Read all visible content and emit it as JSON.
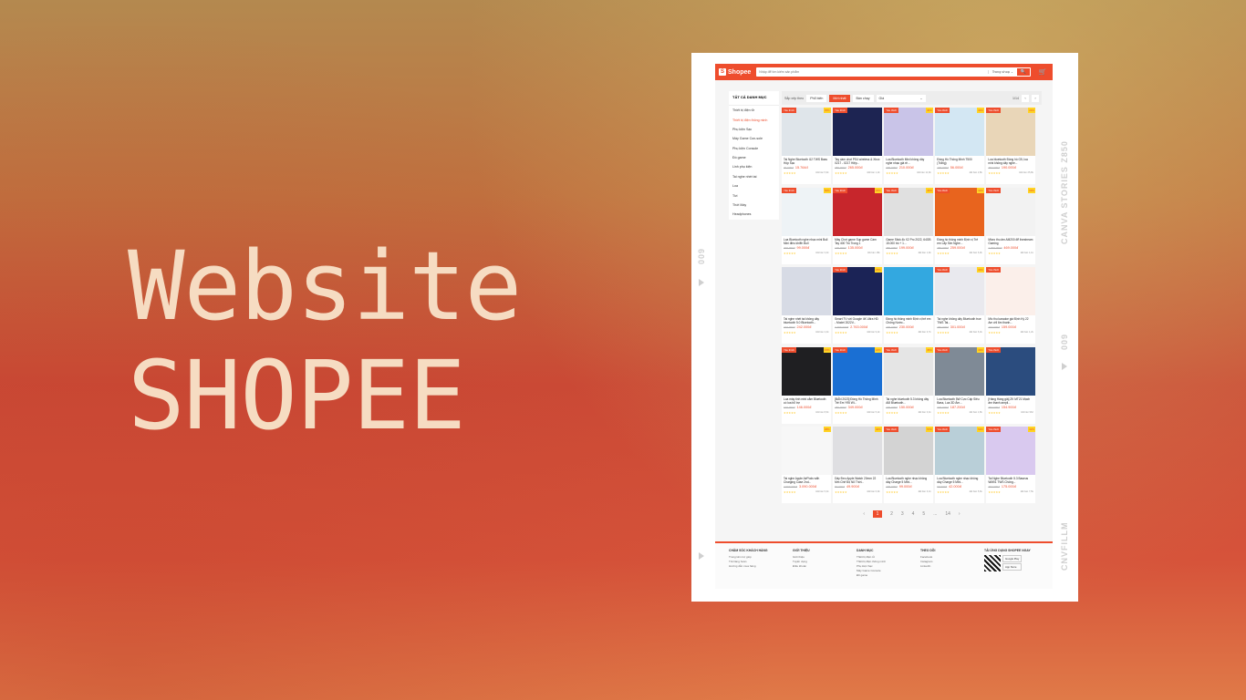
{
  "headline": {
    "line1": "Website",
    "line2": "SHOPEE"
  },
  "film": {
    "right_top": "CANVA STORIES Z850",
    "right_bottom": "CNVFILLM",
    "left_num": "009",
    "right_num": "009"
  },
  "shopee": {
    "logo": "Shopee",
    "logo_mark": "S",
    "search_placeholder": "Nhập để tìm kiếm sản phẩm",
    "search_scope": "Trong shop ⌄",
    "search_icon": "🔍",
    "cart_icon": "🛒",
    "sidebar": {
      "title": "TẤT CẢ DANH MỤC",
      "items": [
        "Thiết bị điện tử",
        "Thiết bị điện thông minh",
        "Phụ kiện Sạc",
        "Máy Game Con-sole",
        "Phụ kiện Console",
        "Đồ game",
        "Linh phụ kiện",
        "Tai nghe nhét tai",
        "Loa",
        "Tivi",
        "Thời Máy",
        "Headphones"
      ]
    },
    "sort": {
      "label": "Sắp xếp theo",
      "options": [
        "Phổ biến",
        "Mới nhất",
        "Bán chạy"
      ],
      "price_label": "Giá",
      "price_caret": "⌄",
      "page": "1/14",
      "prev": "‹",
      "next": "›"
    },
    "products": [
      {
        "name": "Tai Nghe Bluetooth i12 TWS Bass Hộp Sạc",
        "price": "15.764đ",
        "old": "30.000đ",
        "sold": "Đã bán 5,9k",
        "tag": "Yêu thích",
        "disc": "35%",
        "color": "#dfe5ea"
      },
      {
        "name": "Tay cầm chơi PS4 wireless & Xbox 0217 - 0217 Hiệp...",
        "price": "265.000đ",
        "old": "350.000đ",
        "sold": "Đã bán 1,2k",
        "tag": "Yêu thích",
        "disc": "",
        "color": "#1d2452"
      },
      {
        "name": "Loa Bluetooth Mini không dây nghe nhạc giá rẻ...",
        "price": "210.000đ",
        "old": "300.000đ",
        "sold": "Đã bán 11,9k",
        "tag": "Yêu thích",
        "disc": "30%",
        "color": "#c9c4e8"
      },
      {
        "name": "Đồng Hồ Thông Minh T500 (Trắng)",
        "price": "56.000đ",
        "old": "100.000đ",
        "sold": "Đã bán 2,8k",
        "tag": "Yêu thích",
        "disc": "44%",
        "color": "#d3e7f3"
      },
      {
        "name": "Loa bluetooth Đồng hồ G5, loa mini không dây nghe...",
        "price": "190.000đ",
        "old": "250.000đ",
        "sold": "Đã bán 25,8k",
        "tag": "Yêu thích",
        "disc": "24%",
        "color": "#e9d6b8"
      },
      {
        "name": "Loa Bluetooth nghe nhạc mini Bull Mini điều khiển Bull",
        "price": "99.000đ",
        "old": "200.000đ",
        "sold": "Đã bán 3,4k",
        "tag": "Yêu thích",
        "disc": "50%",
        "color": "#eef3f6"
      },
      {
        "name": "Máy Chơi game Sup game Cầm Tay 400 Trò Trong 1",
        "price": "135.000đ",
        "old": "179.000đ",
        "sold": "Đã bán 18k",
        "tag": "Yêu thích",
        "disc": "25%",
        "color": "#c7262c"
      },
      {
        "name": "Game Stick 4k X2 Pro 2022, 64GB 15.000 trò + 1...",
        "price": "199.000đ",
        "old": "350.000đ",
        "sold": "Đã bán 1,9k",
        "tag": "Yêu thích",
        "disc": "43%",
        "color": "#e0e0e0"
      },
      {
        "name": "Đồng hồ thông minh Định vị Trẻ em Lắp Sim Nghe...",
        "price": "259.000đ",
        "old": "450.000đ",
        "sold": "Đã bán 6,9k",
        "tag": "Yêu thích",
        "disc": "42%",
        "color": "#e8641e"
      },
      {
        "name": "Micro thu âm AM200 để livestream Gaming",
        "price": "469.000đ",
        "old": "1.499.000đ",
        "sold": "Đã bán 1,1k",
        "tag": "Yêu thích",
        "disc": "69%",
        "color": "#f2f2f2"
      },
      {
        "name": "Tai nghe nhét tai không dây bluetooth 5.0 Bluetooth...",
        "price": "242.000đ",
        "old": "310.000đ",
        "sold": "Đã bán 2,4k",
        "tag": "",
        "disc": "",
        "color": "#d7dbe5"
      },
      {
        "name": "Smart TV với Google 4K Ultra HD - Model 2022V...",
        "price": "2.763.000đ",
        "old": "3.799.000đ",
        "sold": "Đã bán 9,2k",
        "tag": "Yêu thích",
        "disc": "25%",
        "color": "#1b2356"
      },
      {
        "name": "Đồng hồ thông minh Định vị trẻ em Chống Nước...",
        "price": "230.000đ",
        "old": "400.000đ",
        "sold": "Đã bán 3,7k",
        "tag": "",
        "disc": "",
        "color": "#33a8e0"
      },
      {
        "name": "Tai nghe không dây Bluetooth true TWS Tai...",
        "price": "301.000đ",
        "old": "450.000đ",
        "sold": "Đã bán 6,4k",
        "tag": "Yêu thích",
        "disc": "33%",
        "color": "#e9e9ee"
      },
      {
        "name": "Mic thu karaoke giá Định Kỳ 22 Am chỉ 6m thanh...",
        "price": "159.000đ",
        "old": "190.000đ",
        "sold": "Đã bán 1,2k",
        "tag": "Yêu thích",
        "disc": "",
        "color": "#fbefea"
      },
      {
        "name": "Loa máy tính mini cắm Bluetooth có loa bổ trợ",
        "price": "146.000đ",
        "old": "190.000đ",
        "sold": "Đã bán 8,6k",
        "tag": "Yêu thích",
        "disc": "23%",
        "color": "#1f1f22"
      },
      {
        "name": "[BẢN 2023] Đồng Hồ Thông Minh Trẻ Em Y95 Wi...",
        "price": "349.000đ",
        "old": "450.000đ",
        "sold": "Đã bán 5,2k",
        "tag": "Yêu thích",
        "disc": "22%",
        "color": "#1a6fd3"
      },
      {
        "name": "Tai nghe bluetooth 5.3 không dây AI8 Bluetooth...",
        "price": "150.000đ",
        "old": "230.000đ",
        "sold": "Đã bán 3,4k",
        "tag": "Yêu thích",
        "disc": "35%",
        "color": "#e5e5e5"
      },
      {
        "name": "Loa Bluetooth 5W Cực Cấp Siêu Bass, Loa 3D Âm...",
        "price": "187.200đ",
        "old": "330.000đ",
        "sold": "Đã bán 1,8k",
        "tag": "Yêu thích",
        "disc": "43%",
        "color": "#7f8a96"
      },
      {
        "name": "[Hàng Hàng giá] ZK MT21 Mạch âm thanh ampli...",
        "price": "154.900đ",
        "old": "250.000đ",
        "sold": "Đã bán 962",
        "tag": "Yêu thích",
        "disc": "",
        "color": "#2b4c7e"
      },
      {
        "name": "Tai nghe Apple AirPods with Charging Case 2nd...",
        "price": "3.090.000đ",
        "old": "4.999.000đ",
        "sold": "Đã bán 5,4k",
        "tag": "",
        "disc": "38%",
        "color": "#f7f7f7"
      },
      {
        "name": "Dây Đeo Apple Watch 20mm 22 Mm Chế Độ Nỗ Thời...",
        "price": "49.900đ",
        "old": "82.000đ",
        "sold": "Đã bán 6,9k",
        "tag": "",
        "disc": "40%",
        "color": "#dfdfe2"
      },
      {
        "name": "Loa Bluetooth nghe nhạc không dây Charge 5 Mini...",
        "price": "99.000đ",
        "old": "230.000đ",
        "sold": "Đã bán 3,1k",
        "tag": "Yêu thích",
        "disc": "57%",
        "color": "#d3d3d3"
      },
      {
        "name": "Loa Bluetooth nghe nhạc không dây Charge 5 Mini...",
        "price": "42.000đ",
        "old": "90.000đ",
        "sold": "Đã bán 5,6k",
        "tag": "Yêu thích",
        "disc": "53%",
        "color": "#b9cfd8"
      },
      {
        "name": "Tai Nghe Bluetooth 5.3 Baseus WM01 TWS Chống...",
        "price": "175.000đ",
        "old": "260.000đ",
        "sold": "Đã bán 7,5k",
        "tag": "Yêu thích",
        "disc": "32%",
        "color": "#d9c9ef"
      }
    ],
    "pager": {
      "prev": "‹",
      "pages": [
        "1",
        "2",
        "3",
        "4",
        "5",
        "...",
        "14"
      ],
      "next": "›"
    },
    "footer": [
      {
        "title": "CHĂM SÓC KHÁCH HÀNG",
        "items": [
          "Trung tâm trợ giúp",
          "Trả hàng hoàn",
          "Hướng dẫn mua hàng"
        ]
      },
      {
        "title": "GIỚI THIỆU",
        "items": [
          "Giới thiệu",
          "Tuyển dụng",
          "Điều khoản"
        ]
      },
      {
        "title": "DANH MỤC",
        "items": [
          "Thiết bị điện tử",
          "Thiết bị điện thông minh",
          "Phụ kiện Sạc",
          "Máy Game Console",
          "Đồ game"
        ]
      },
      {
        "title": "THEO DÕI",
        "items": [
          "Facebook",
          "Instagram",
          "LinkedIn"
        ]
      },
      {
        "title": "TẢI ỨNG DỤNG SHOPEE NGAY",
        "items": [
          "Google Play",
          "App Store"
        ]
      }
    ]
  }
}
